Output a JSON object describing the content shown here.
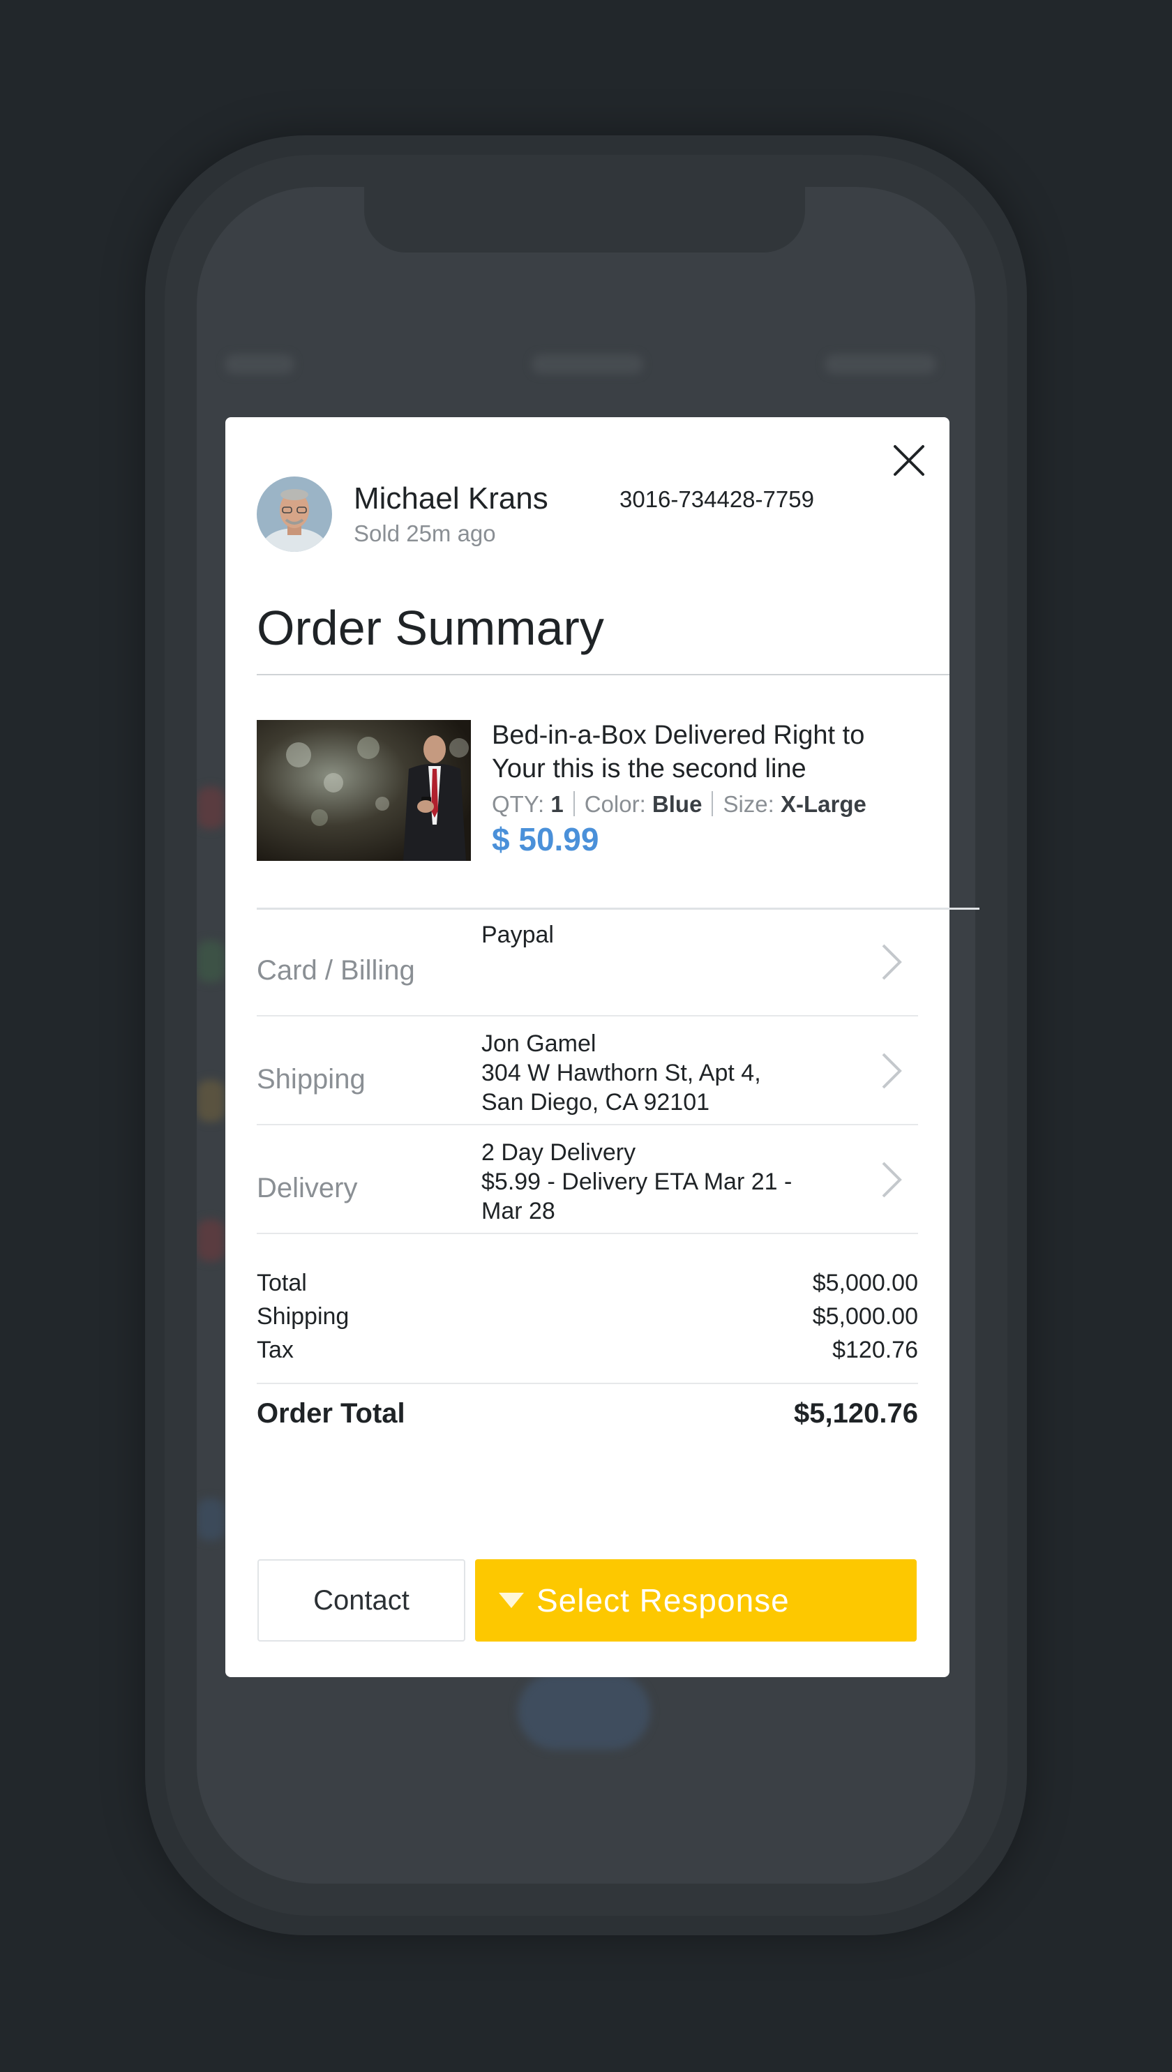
{
  "seller": {
    "name": "Michael Krans",
    "sold_time": "Sold 25m ago",
    "order_id": "3016-734428-7759"
  },
  "summary": {
    "title": "Order Summary"
  },
  "product": {
    "name_line1": "Bed-in-a-Box Delivered Right to",
    "name_line2": "Your this is the second line",
    "qty_label": "QTY:",
    "qty_value": "1",
    "color_label": "Color:",
    "color_value": "Blue",
    "size_label": "Size:",
    "size_value": "X-Large",
    "price": "$ 50.99"
  },
  "details": [
    {
      "label": "Card / Billing",
      "lines": [
        "Paypal",
        "",
        ""
      ]
    },
    {
      "label": "Shipping",
      "lines": [
        "Jon Gamel",
        "304 W Hawthorn St, Apt 4,",
        "San Diego, CA 92101"
      ]
    },
    {
      "label": "Delivery",
      "lines": [
        "2 Day Delivery",
        "$5.99 - Delivery ETA Mar 21 -",
        "Mar 28"
      ]
    }
  ],
  "totals": {
    "total_label": "Total",
    "total_value": "$5,000.00",
    "shipping_label": "Shipping",
    "shipping_value": "$5,000.00",
    "tax_label": "Tax",
    "tax_value": "$120.76",
    "order_total_label": "Order Total",
    "order_total_value": "$5,120.76"
  },
  "actions": {
    "contact_label": "Contact",
    "response_label": "Select Response"
  },
  "colors": {
    "accent_price": "#4a90d9",
    "response_button": "#fdc800",
    "background": "#22272b"
  },
  "icons": {
    "close": "close-icon",
    "chevron": "chevron-right-icon",
    "dropdown": "caret-down-icon"
  }
}
